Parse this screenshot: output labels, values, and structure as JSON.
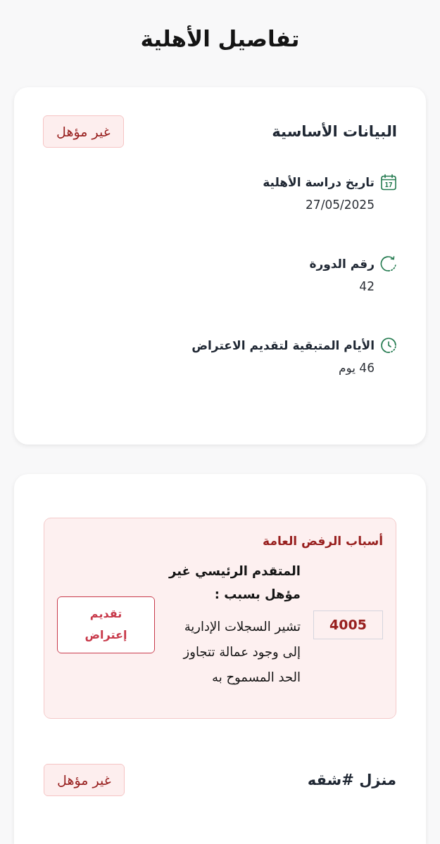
{
  "page": {
    "title": "تفاصيل الأهلية"
  },
  "basic_info": {
    "title": "البيانات الأساسية",
    "status_badge": "غير مؤهل",
    "fields": [
      {
        "kind": "calendar",
        "icon_text": "17",
        "label": "تاريخ دراسة الأهلية",
        "value": "27/05/2025"
      },
      {
        "kind": "cycle",
        "label": "رقم الدورة",
        "value": "42"
      },
      {
        "kind": "timer",
        "label": "الأيام المتبقية لتقديم الاعتراض",
        "value": "46 يوم"
      }
    ]
  },
  "rejection": {
    "title": "أسباب الرفض العامة",
    "reasons": [
      {
        "code": "4005",
        "heading": "المتقدم الرئيسي غير مؤهل بسبب :",
        "description": "تشير السجلات الإدارية إلى وجود عمالة تتجاوز الحد المسموح به",
        "action": "تقديم إعتراض"
      }
    ]
  },
  "units": [
    {
      "title": "منزل #شقه",
      "status_badge": "غير مؤهل"
    }
  ]
}
